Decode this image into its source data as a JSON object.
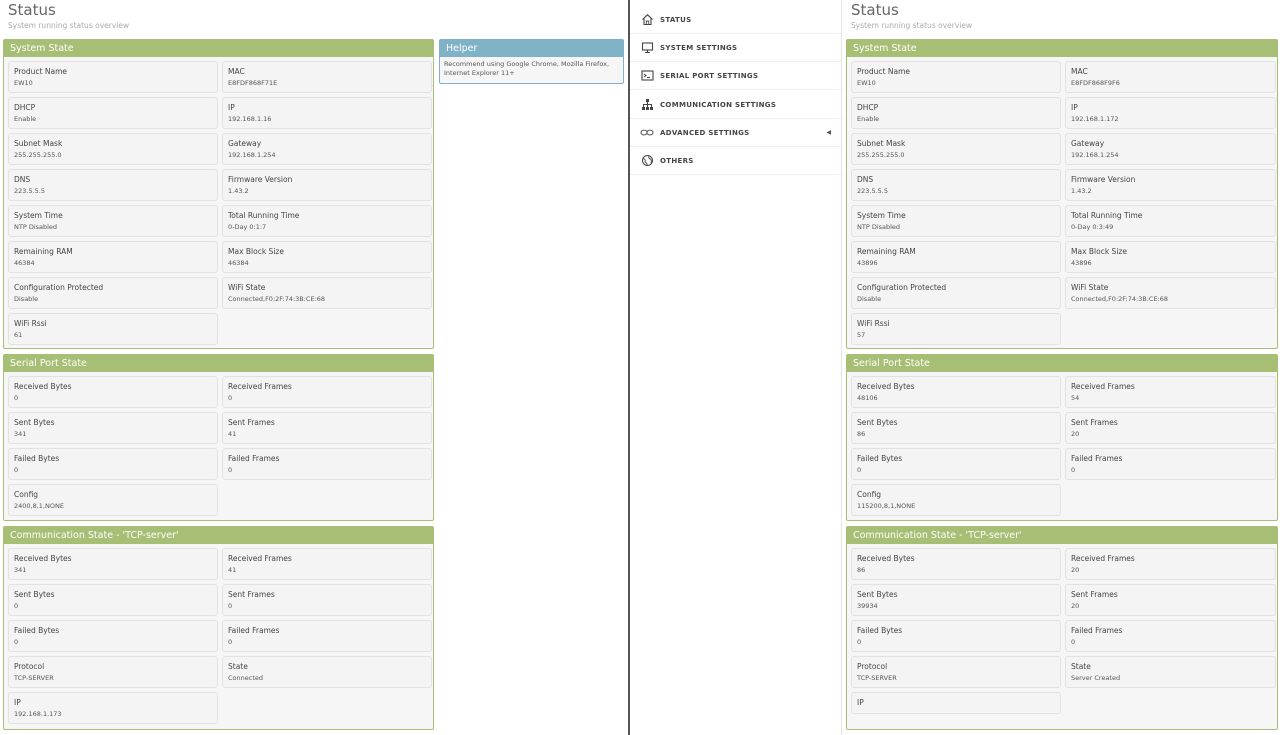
{
  "left": {
    "title": "Status",
    "subtitle": "System running status overview",
    "system": {
      "header": "System State",
      "items": [
        {
          "k": "Product Name",
          "v": "EW10"
        },
        {
          "k": "MAC",
          "v": "E8FDF868F71E"
        },
        {
          "k": "DHCP",
          "v": "Enable"
        },
        {
          "k": "IP",
          "v": "192.168.1.16"
        },
        {
          "k": "Subnet Mask",
          "v": "255.255.255.0"
        },
        {
          "k": "Gateway",
          "v": "192.168.1.254"
        },
        {
          "k": "DNS",
          "v": "223.5.5.5"
        },
        {
          "k": "Firmware Version",
          "v": "1.43.2"
        },
        {
          "k": "System Time",
          "v": "NTP Disabled"
        },
        {
          "k": "Total Running Time",
          "v": "0-Day 0:1:7"
        },
        {
          "k": "Remaining RAM",
          "v": "46384"
        },
        {
          "k": "Max Block Size",
          "v": "46384"
        },
        {
          "k": "Configuration Protected",
          "v": "Disable"
        },
        {
          "k": "WiFi State",
          "v": "Connected,F0:2F:74:3B:CE:68"
        },
        {
          "k": "WiFi Rssi",
          "v": "61"
        }
      ]
    },
    "serial": {
      "header": "Serial Port State",
      "items": [
        {
          "k": "Received Bytes",
          "v": "0"
        },
        {
          "k": "Received Frames",
          "v": "0"
        },
        {
          "k": "Sent Bytes",
          "v": "341"
        },
        {
          "k": "Sent Frames",
          "v": "41"
        },
        {
          "k": "Failed Bytes",
          "v": "0"
        },
        {
          "k": "Failed Frames",
          "v": "0"
        },
        {
          "k": "Config",
          "v": "2400,8,1,NONE"
        }
      ]
    },
    "comm": {
      "header": "Communication State - 'TCP-server'",
      "items": [
        {
          "k": "Received Bytes",
          "v": "341"
        },
        {
          "k": "Received Frames",
          "v": "41"
        },
        {
          "k": "Sent Bytes",
          "v": "0"
        },
        {
          "k": "Sent Frames",
          "v": "0"
        },
        {
          "k": "Failed Bytes",
          "v": "0"
        },
        {
          "k": "Failed Frames",
          "v": "0"
        },
        {
          "k": "Protocol",
          "v": "TCP-SERVER"
        },
        {
          "k": "State",
          "v": "Connected"
        },
        {
          "k": "IP",
          "v": "192.168.1.173"
        }
      ]
    },
    "helper": {
      "header": "Helper",
      "text": "Recommend using Google Chrome, Mozilla Firefox, Internet Explorer 11+"
    }
  },
  "nav": {
    "items": [
      {
        "label": "STATUS",
        "icon": "home-icon"
      },
      {
        "label": "SYSTEM SETTINGS",
        "icon": "monitor-icon"
      },
      {
        "label": "SERIAL PORT SETTINGS",
        "icon": "terminal-icon"
      },
      {
        "label": "COMMUNICATION SETTINGS",
        "icon": "network-icon"
      },
      {
        "label": "ADVANCED SETTINGS",
        "icon": "infinity-icon"
      },
      {
        "label": "OTHERS",
        "icon": "globe-icon"
      }
    ]
  },
  "right": {
    "title": "Status",
    "subtitle": "System running status overview",
    "system": {
      "header": "System State",
      "items": [
        {
          "k": "Product Name",
          "v": "EW10"
        },
        {
          "k": "MAC",
          "v": "E8FDF868F9F6"
        },
        {
          "k": "DHCP",
          "v": "Enable"
        },
        {
          "k": "IP",
          "v": "192.168.1.172"
        },
        {
          "k": "Subnet Mask",
          "v": "255.255.255.0"
        },
        {
          "k": "Gateway",
          "v": "192.168.1.254"
        },
        {
          "k": "DNS",
          "v": "223.5.5.5"
        },
        {
          "k": "Firmware Version",
          "v": "1.43.2"
        },
        {
          "k": "System Time",
          "v": "NTP Disabled"
        },
        {
          "k": "Total Running Time",
          "v": "0-Day 0:3:49"
        },
        {
          "k": "Remaining RAM",
          "v": "43896"
        },
        {
          "k": "Max Block Size",
          "v": "43896"
        },
        {
          "k": "Configuration Protected",
          "v": "Disable"
        },
        {
          "k": "WiFi State",
          "v": "Connected,F0:2F:74:3B:CE:68"
        },
        {
          "k": "WiFi Rssi",
          "v": "57"
        }
      ]
    },
    "serial": {
      "header": "Serial Port State",
      "items": [
        {
          "k": "Received Bytes",
          "v": "48106"
        },
        {
          "k": "Received Frames",
          "v": "54"
        },
        {
          "k": "Sent Bytes",
          "v": "86"
        },
        {
          "k": "Sent Frames",
          "v": "20"
        },
        {
          "k": "Failed Bytes",
          "v": "0"
        },
        {
          "k": "Failed Frames",
          "v": "0"
        },
        {
          "k": "Config",
          "v": "115200,8,1,NONE"
        }
      ]
    },
    "comm": {
      "header": "Communication State - 'TCP-server'",
      "items": [
        {
          "k": "Received Bytes",
          "v": "86"
        },
        {
          "k": "Received Frames",
          "v": "20"
        },
        {
          "k": "Sent Bytes",
          "v": "39934"
        },
        {
          "k": "Sent Frames",
          "v": "20"
        },
        {
          "k": "Failed Bytes",
          "v": "0"
        },
        {
          "k": "Failed Frames",
          "v": "0"
        },
        {
          "k": "Protocol",
          "v": "TCP-SERVER"
        },
        {
          "k": "State",
          "v": "Server Created"
        },
        {
          "k": "IP",
          "v": ""
        }
      ]
    }
  },
  "colors": {
    "panel_green": "#a6bf75",
    "helper_blue": "#7fb2c6"
  }
}
